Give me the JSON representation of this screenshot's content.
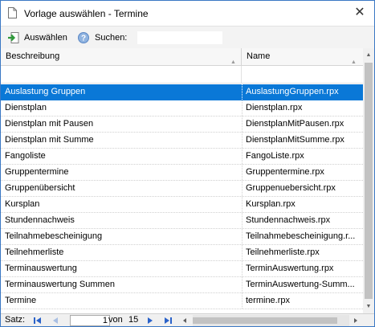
{
  "window": {
    "title": "Vorlage auswählen - Termine",
    "close_glyph": "✕"
  },
  "toolbar": {
    "select_label": "Auswählen",
    "search_label": "Suchen:",
    "search_value": ""
  },
  "columns": {
    "description": "Beschreibung",
    "name": "Name"
  },
  "rows": [
    {
      "desc": "Auslastung Gruppen",
      "name": "AuslastungGruppen.rpx"
    },
    {
      "desc": "Dienstplan",
      "name": "Dienstplan.rpx"
    },
    {
      "desc": "Dienstplan mit Pausen",
      "name": "DienstplanMitPausen.rpx"
    },
    {
      "desc": "Dienstplan mit Summe",
      "name": "DienstplanMitSumme.rpx"
    },
    {
      "desc": "Fangoliste",
      "name": "FangoListe.rpx"
    },
    {
      "desc": "Gruppentermine",
      "name": "Gruppentermine.rpx"
    },
    {
      "desc": "Gruppenübersicht",
      "name": "Gruppenuebersicht.rpx"
    },
    {
      "desc": "Kursplan",
      "name": "Kursplan.rpx"
    },
    {
      "desc": "Stundennachweis",
      "name": "Stundennachweis.rpx"
    },
    {
      "desc": "Teilnahmebescheinigung",
      "name": "Teilnahmebescheinigung.r..."
    },
    {
      "desc": "Teilnehmerliste",
      "name": "Teilnehmerliste.rpx"
    },
    {
      "desc": "Terminauswertung",
      "name": "TerminAuswertung.rpx"
    },
    {
      "desc": "Terminauswertung Summen",
      "name": "TerminAuswertung-Summ..."
    },
    {
      "desc": "Termine",
      "name": "termine.rpx"
    }
  ],
  "selected_row_index": 0,
  "status": {
    "record_label": "Satz:",
    "current_page": "1",
    "of_label": "von",
    "total": "15"
  },
  "colors": {
    "selection": "#0a78d7",
    "window_border": "#3b78c4",
    "nav_icon": "#2a62c9"
  }
}
